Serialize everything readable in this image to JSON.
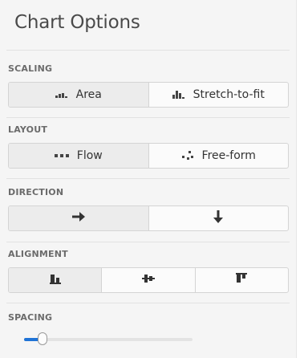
{
  "panel": {
    "title": "Chart Options"
  },
  "scaling": {
    "label": "SCALING",
    "options": [
      {
        "label": "Area",
        "icon": "area-scaling-icon"
      },
      {
        "label": "Stretch-to-fit",
        "icon": "stretch-to-fit-icon"
      }
    ],
    "selected": "Area"
  },
  "layout": {
    "label": "LAYOUT",
    "options": [
      {
        "label": "Flow",
        "icon": "flow-layout-icon"
      },
      {
        "label": "Free-form",
        "icon": "free-form-layout-icon"
      }
    ],
    "selected": "Flow"
  },
  "direction": {
    "label": "DIRECTION",
    "options": [
      {
        "icon": "arrow-right-icon"
      },
      {
        "icon": "arrow-down-icon"
      }
    ],
    "selected": "arrow-right-icon"
  },
  "alignment": {
    "label": "ALIGNMENT",
    "options": [
      {
        "icon": "align-bottom-icon"
      },
      {
        "icon": "align-center-icon"
      },
      {
        "icon": "align-top-icon"
      }
    ],
    "selected": "align-bottom-icon"
  },
  "spacing": {
    "label": "SPACING",
    "value_fraction": 0.11
  },
  "colors": {
    "accent": "#1f73d6",
    "panel_bg": "#f5f5f5",
    "selected_bg": "#ececec",
    "border": "#d4d4d4"
  }
}
